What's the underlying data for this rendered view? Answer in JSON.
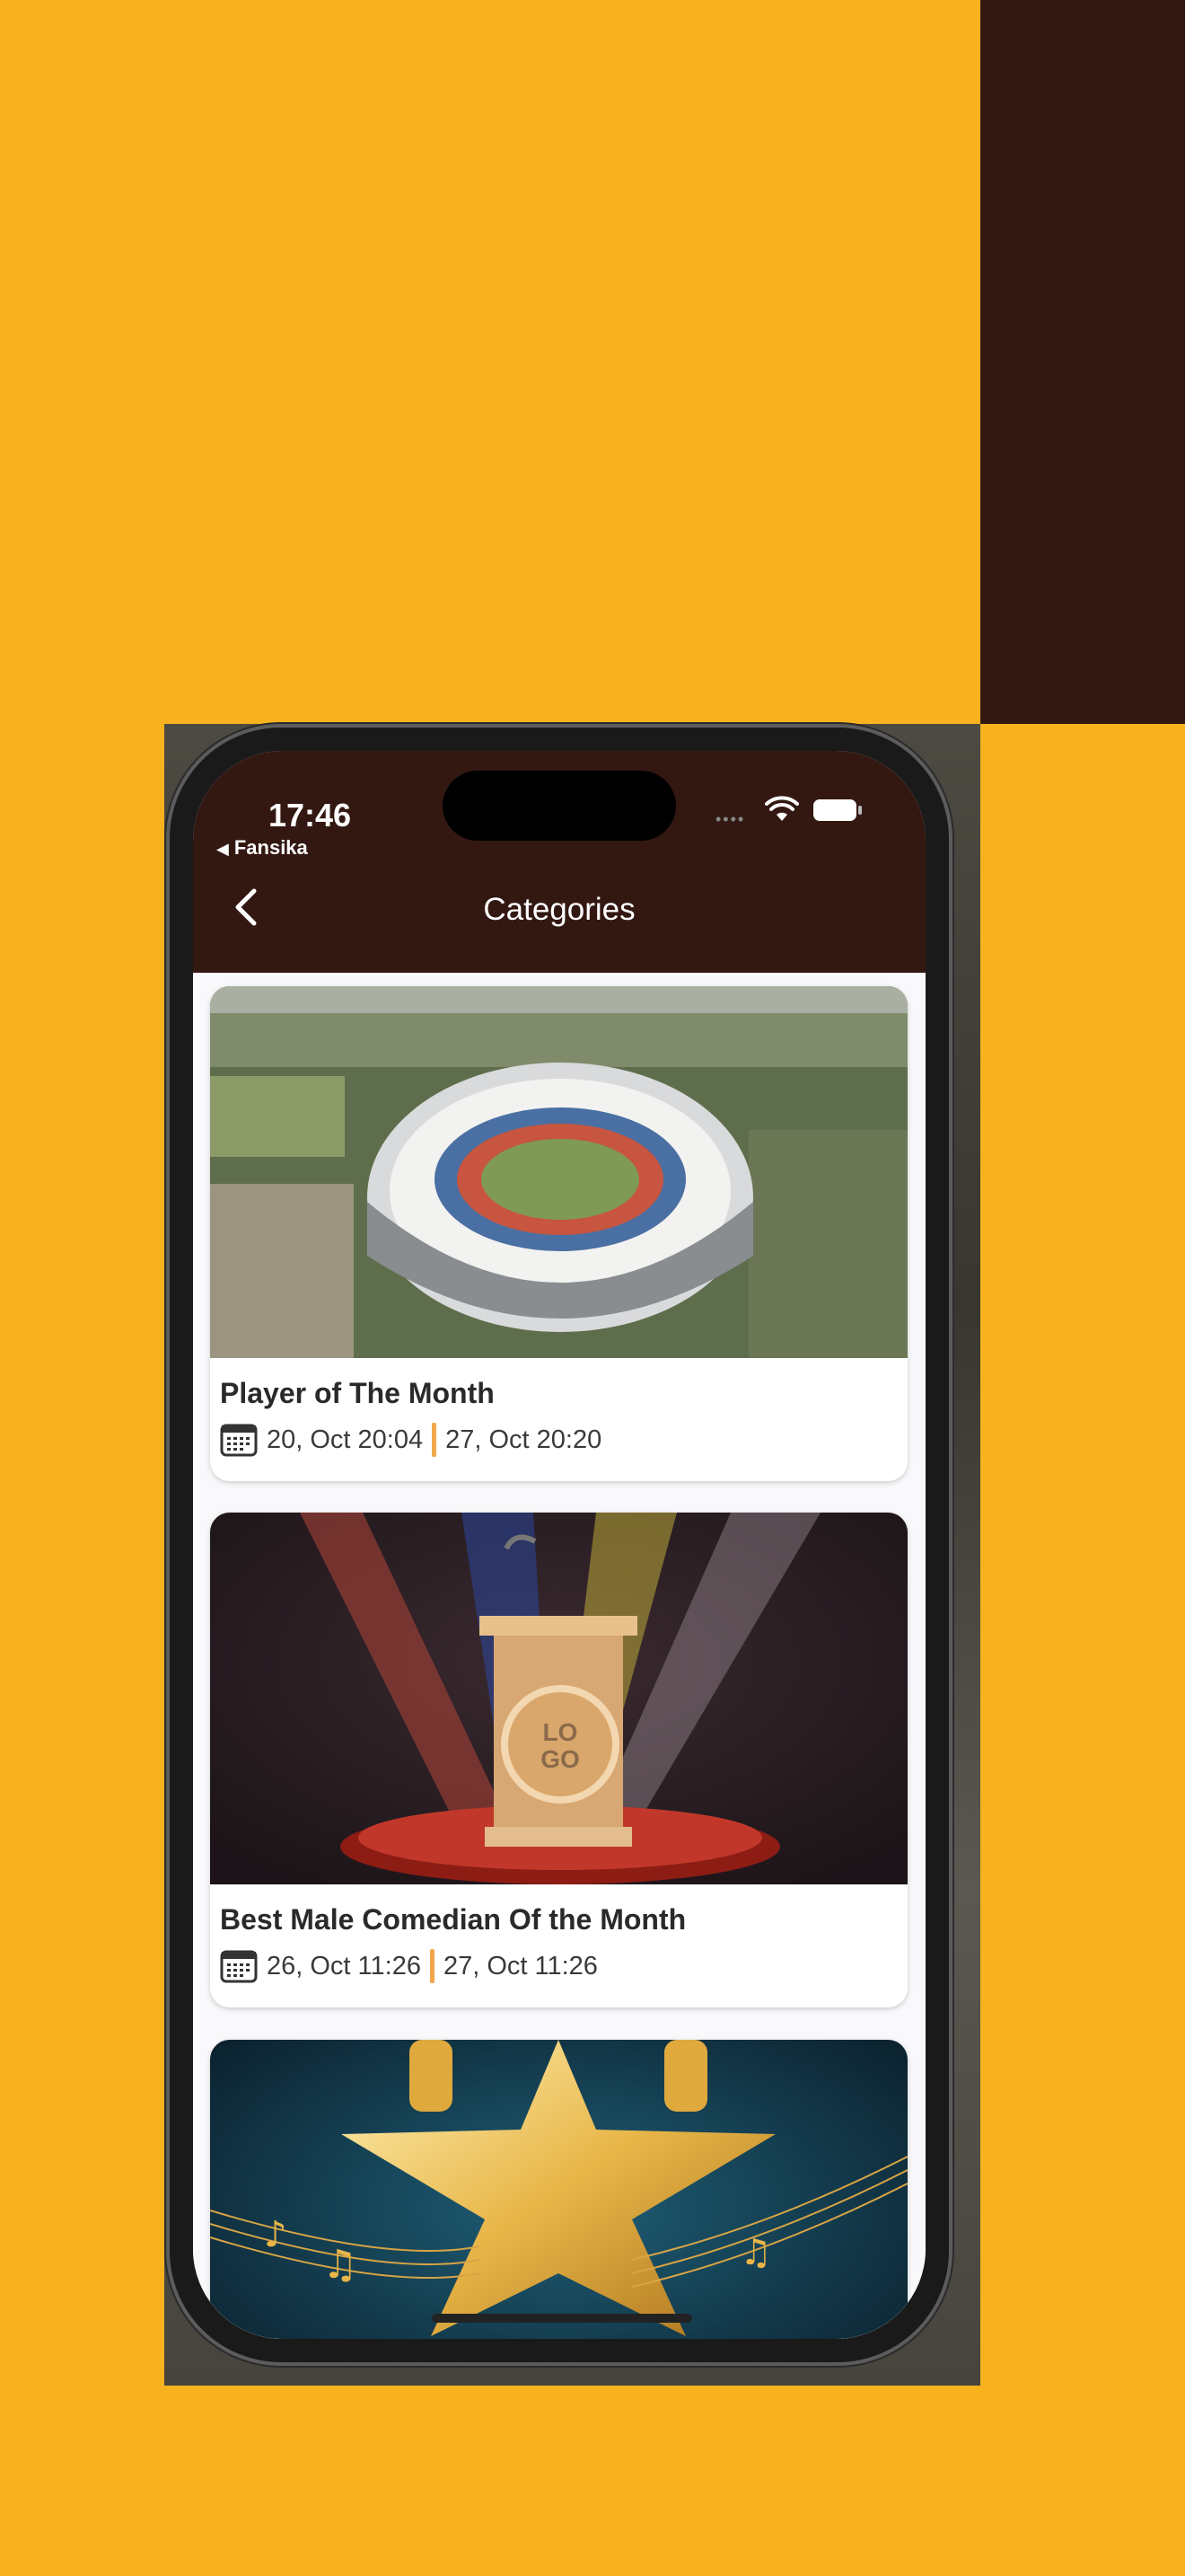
{
  "status_bar": {
    "time": "17:46",
    "back_app": "Fansika"
  },
  "nav": {
    "title": "Categories"
  },
  "categories": [
    {
      "title": "Player of The Month",
      "start": "20, Oct 20:04",
      "end": "27, Oct 20:20",
      "image": "stadium-aerial"
    },
    {
      "title": "Best Male Comedian Of the Month",
      "start": "26, Oct 11:26",
      "end": "27, Oct 11:26",
      "image": "podium-spotlights",
      "logo_text": [
        "LO",
        "GO"
      ]
    },
    {
      "image": "golden-star-music"
    }
  ],
  "colors": {
    "background": "#f7b21e",
    "header": "#331812",
    "separator": "#f0a84a"
  }
}
